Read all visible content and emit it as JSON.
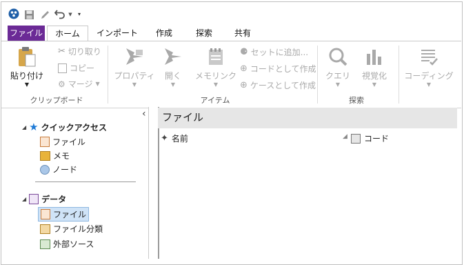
{
  "quick_access_toolbar": {
    "icons": [
      "app-logo-icon",
      "save-icon",
      "pen-icon",
      "undo-icon",
      "dropdown-icon",
      "customize-icon"
    ]
  },
  "tabs": [
    {
      "label": "ファイル"
    },
    {
      "label": "ホーム"
    },
    {
      "label": "インポート"
    },
    {
      "label": "作成"
    },
    {
      "label": "探索"
    },
    {
      "label": "共有"
    }
  ],
  "ribbon": {
    "clipboard": {
      "paste": "貼り付け",
      "cut": "切り取り",
      "copy": "コピー",
      "merge": "マージ",
      "label": "クリップボード"
    },
    "items": {
      "properties": "プロパティ",
      "open": "開く",
      "memolink": "メモリンク",
      "add_to_set": "セットに追加...",
      "create_as_code": "コードとして作成",
      "create_as_case": "ケースとして作成",
      "label": "アイテム"
    },
    "explore": {
      "query": "クエリ",
      "visualize": "視覚化",
      "label": "探索"
    },
    "coding": {
      "label": "コーディング"
    }
  },
  "nav": {
    "collapse_glyph": "‹",
    "quick_access": {
      "label": "クイックアクセス",
      "items": [
        "ファイル",
        "メモ",
        "ノード"
      ]
    },
    "data": {
      "label": "データ",
      "items": [
        "ファイル",
        "ファイル分類",
        "外部ソース"
      ]
    }
  },
  "main": {
    "title": "ファイル",
    "columns": [
      "名前",
      "コード"
    ]
  }
}
